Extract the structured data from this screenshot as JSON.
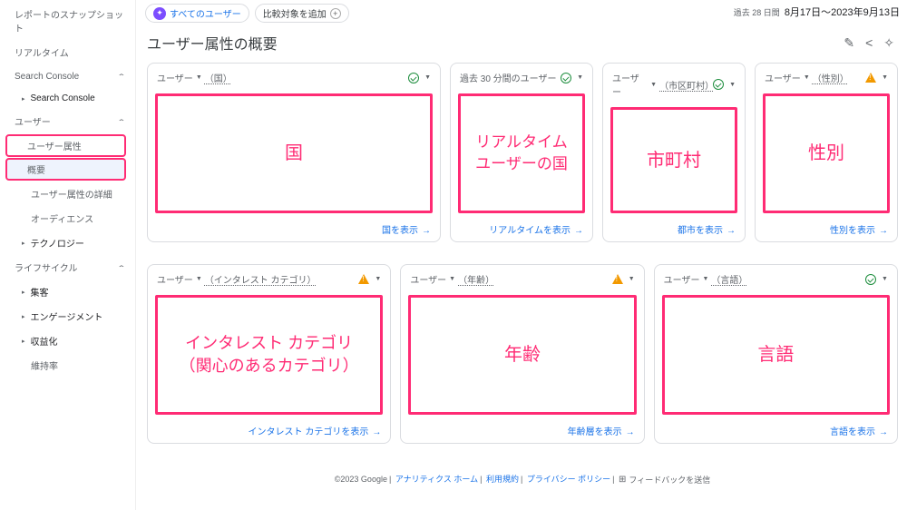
{
  "topbar": {
    "allUsers": "すべてのユーザー",
    "addCompare": "比較対象を追加",
    "periodLabel": "過去 28 日間",
    "dateRange": "8月17日～2023年9月13日"
  },
  "title": "ユーザー属性の概要",
  "sidebar": {
    "snapshot": "レポートのスナップショット",
    "realtime": "リアルタイム",
    "searchConsole": "Search Console",
    "searchConsoleItem": "Search Console",
    "userSection": "ユーザー",
    "userAttr": "ユーザー属性",
    "overview": "概要",
    "userAttrDetail": "ユーザー属性の詳細",
    "audience": "オーディエンス",
    "technology": "テクノロジー",
    "lifecycle": "ライフサイクル",
    "acquisition": "集客",
    "engagement": "エンゲージメント",
    "monetize": "収益化",
    "retention": "維持率"
  },
  "cards": {
    "country": {
      "head": "ユーザー",
      "dim": "（国）",
      "body": "国",
      "foot": "国を表示"
    },
    "realtime": {
      "head": "過去 30 分間のユーザー",
      "body": "リアルタイム\nユーザーの国",
      "foot": "リアルタイムを表示"
    },
    "city": {
      "head": "ユーザー",
      "dim": "（市区町村）",
      "body": "市町村",
      "foot": "都市を表示"
    },
    "gender": {
      "head": "ユーザー",
      "dim": "（性別）",
      "body": "性別",
      "foot": "性別を表示"
    },
    "interest": {
      "head": "ユーザー",
      "dim": "（インタレスト カテゴリ）",
      "body": "インタレスト カテゴリ\n（関心のあるカテゴリ）",
      "foot": "インタレスト カテゴリを表示"
    },
    "age": {
      "head": "ユーザー",
      "dim": "（年齢）",
      "body": "年齢",
      "foot": "年齢層を表示"
    },
    "lang": {
      "head": "ユーザー",
      "dim": "（言語）",
      "body": "言語",
      "foot": "言語を表示"
    }
  },
  "footer": {
    "copyright": "©2023 Google",
    "home": "アナリティクス ホーム",
    "terms": "利用規約",
    "privacy": "プライバシー ポリシー",
    "feedback": "フィードバックを送信"
  }
}
